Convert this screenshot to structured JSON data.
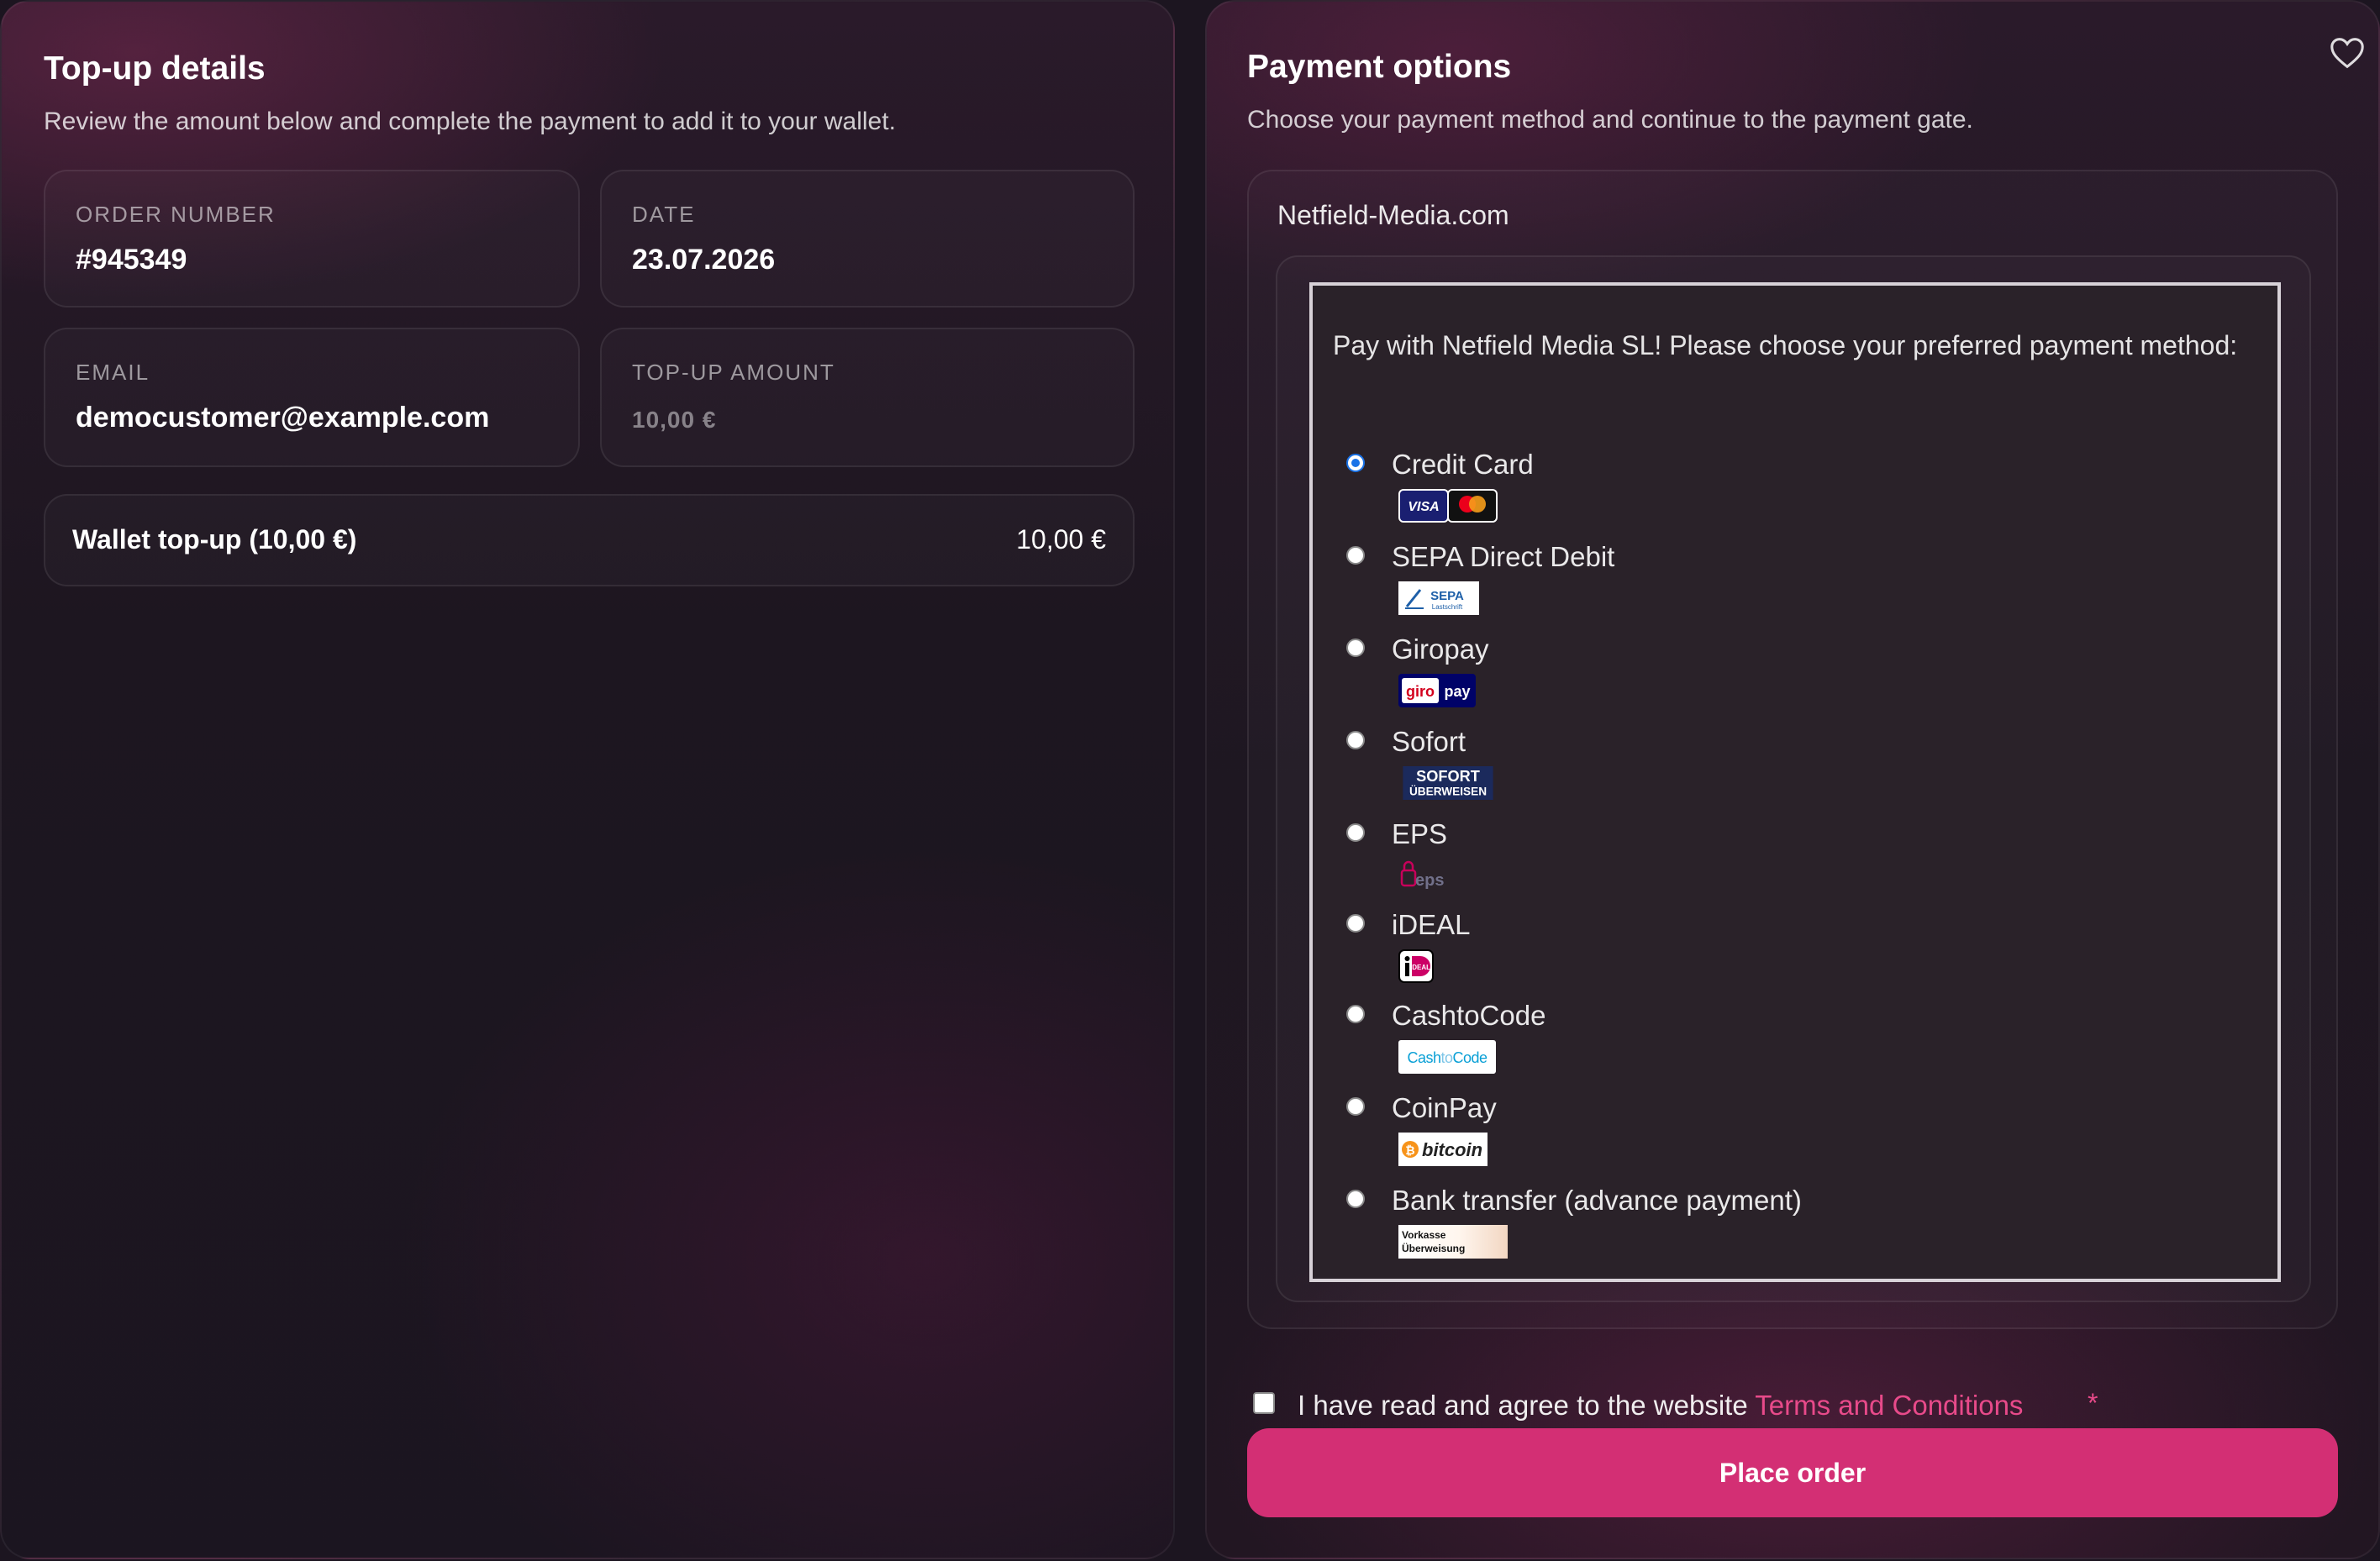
{
  "left": {
    "title": "Top-up details",
    "subtitle": "Review the amount below and complete the payment to add it to your wallet.",
    "order_number": {
      "label": "ORDER NUMBER",
      "value": "#945349"
    },
    "date": {
      "label": "DATE",
      "value": "23.07.2026"
    },
    "email": {
      "label": "EMAIL",
      "value": "democustomer@example.com"
    },
    "topup_amount": {
      "label": "TOP-UP AMOUNT",
      "value": "10,00 €"
    },
    "summary": {
      "label": "Wallet top-up (10,00 €)",
      "value": "10,00 €"
    }
  },
  "right": {
    "title": "Payment options",
    "subtitle": "Choose your payment method and continue to the payment gate.",
    "favorite_icon": "heart-icon",
    "gateway_name": "Netfield-Media.com",
    "intro": "Pay with Netfield Media SL! Please choose your preferred payment method:",
    "methods": [
      {
        "name": "Credit Card",
        "selected": true,
        "logo": "visa-mastercard-logo"
      },
      {
        "name": "SEPA Direct Debit",
        "selected": false,
        "logo": "sepa-logo",
        "logo_text": "SEPA",
        "logo_subtext": "Lastschrift"
      },
      {
        "name": "Giropay",
        "selected": false,
        "logo": "giropay-logo",
        "logo_text_a": "giro",
        "logo_text_b": "pay"
      },
      {
        "name": "Sofort",
        "selected": false,
        "logo": "sofort-logo",
        "logo_text": "SOFORT",
        "logo_subtext": "ÜBERWEISEN"
      },
      {
        "name": "EPS",
        "selected": false,
        "logo": "eps-logo",
        "logo_text": "eps"
      },
      {
        "name": "iDEAL",
        "selected": false,
        "logo": "ideal-logo",
        "logo_text": "iDEAL"
      },
      {
        "name": "CashtoCode",
        "selected": false,
        "logo": "cashtocode-logo",
        "logo_text_a": "Cash",
        "logo_text_b": "to",
        "logo_text_c": "Code"
      },
      {
        "name": "CoinPay",
        "selected": false,
        "logo": "bitcoin-logo",
        "logo_text": "bitcoin"
      },
      {
        "name": "Bank transfer (advance payment)",
        "selected": false,
        "logo": "bank-transfer-logo",
        "logo_text_a": "Vorkasse",
        "logo_text_b": "Überweisung"
      }
    ],
    "terms_text": "I have read and agree to the website ",
    "terms_link": "Terms and Conditions",
    "required_mark": "*",
    "place_order": "Place order"
  },
  "colors": {
    "accent": "#d32f74",
    "link": "#e84a8a",
    "radio_selected": "#1a73e8"
  }
}
